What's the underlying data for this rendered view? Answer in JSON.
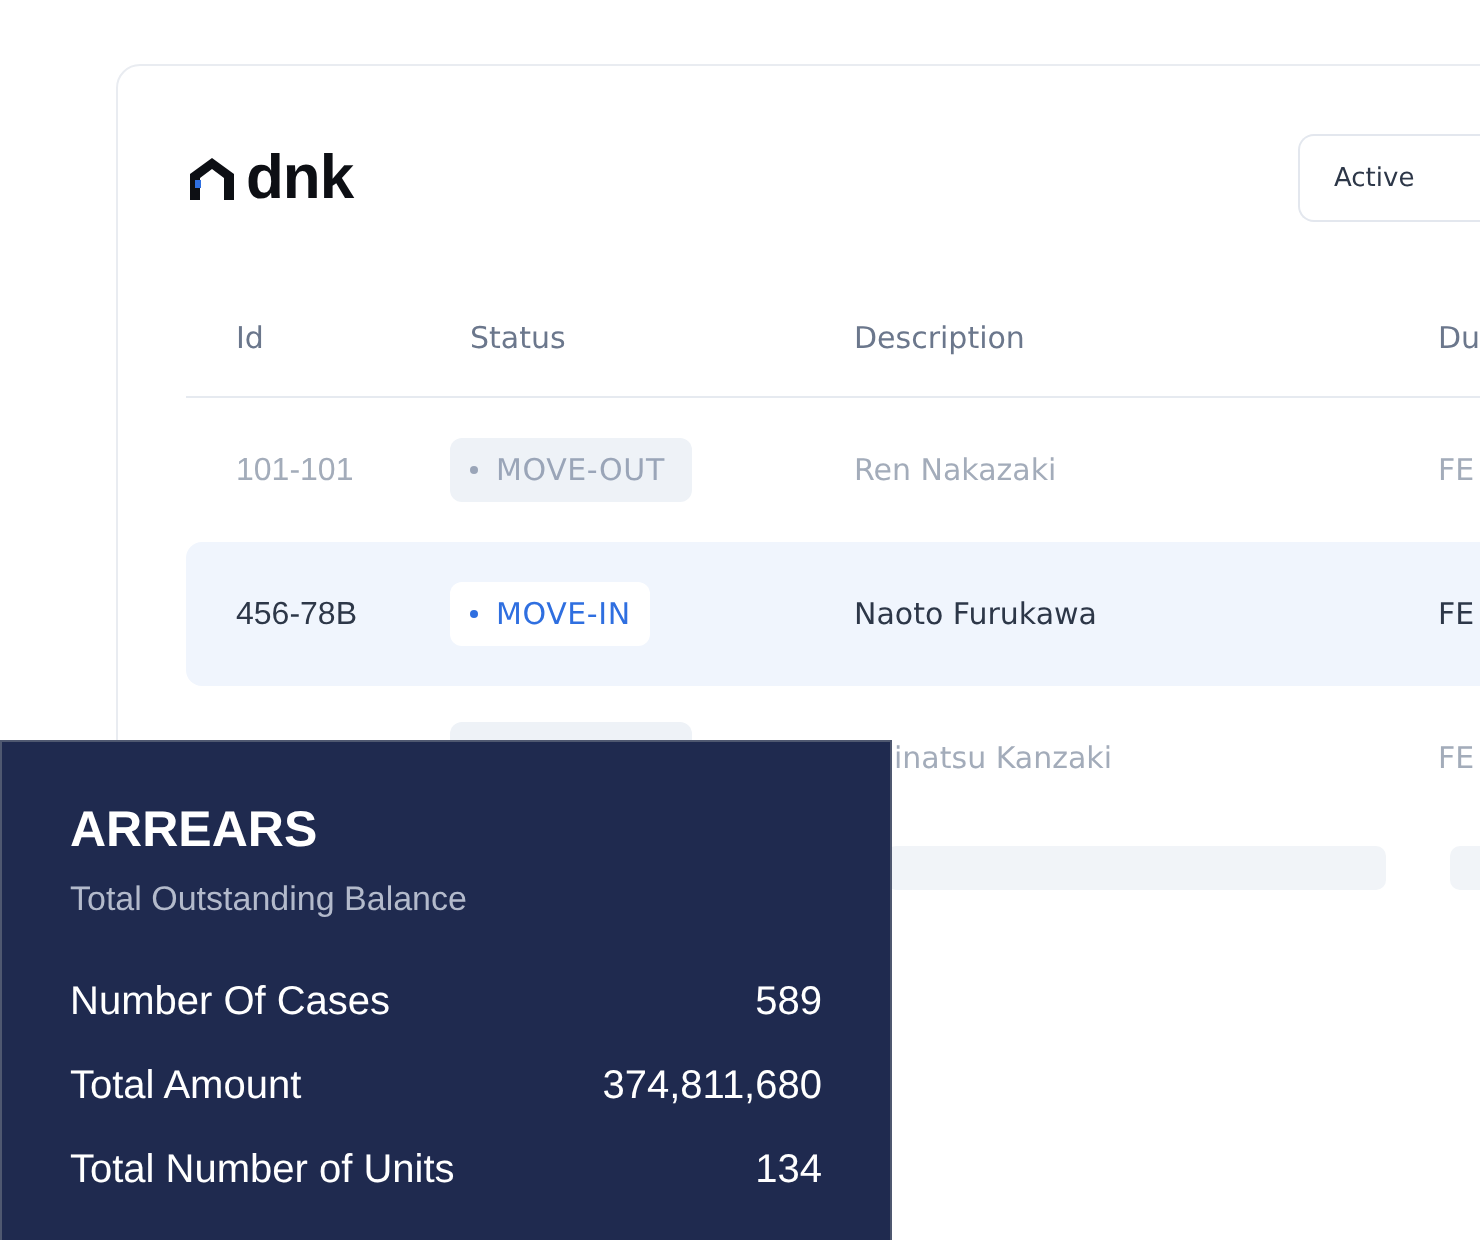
{
  "logo": {
    "text": "dnk"
  },
  "filter": {
    "value": "Active"
  },
  "table": {
    "columns": [
      "Id",
      "Status",
      "Description",
      "Du"
    ],
    "rows": [
      {
        "id": "101-101",
        "status": "MOVE-OUT",
        "description": "Ren Nakazaki",
        "column_4": "FE",
        "selected": false
      },
      {
        "id": "456-78B",
        "status": "MOVE-IN",
        "description": "Naoto Furukawa",
        "column_4": "FE",
        "selected": true
      },
      {
        "description": "inatsu Kanzaki",
        "column_4": "FE",
        "selected": false
      }
    ]
  },
  "arrears": {
    "title": "ARREARS",
    "subtitle": "Total Outstanding Balance",
    "stats": [
      {
        "label": "Number Of Cases",
        "value": "589"
      },
      {
        "label": "Total Amount",
        "value": "374,811,680"
      },
      {
        "label": "Total Number of Units",
        "value": "134"
      }
    ]
  }
}
